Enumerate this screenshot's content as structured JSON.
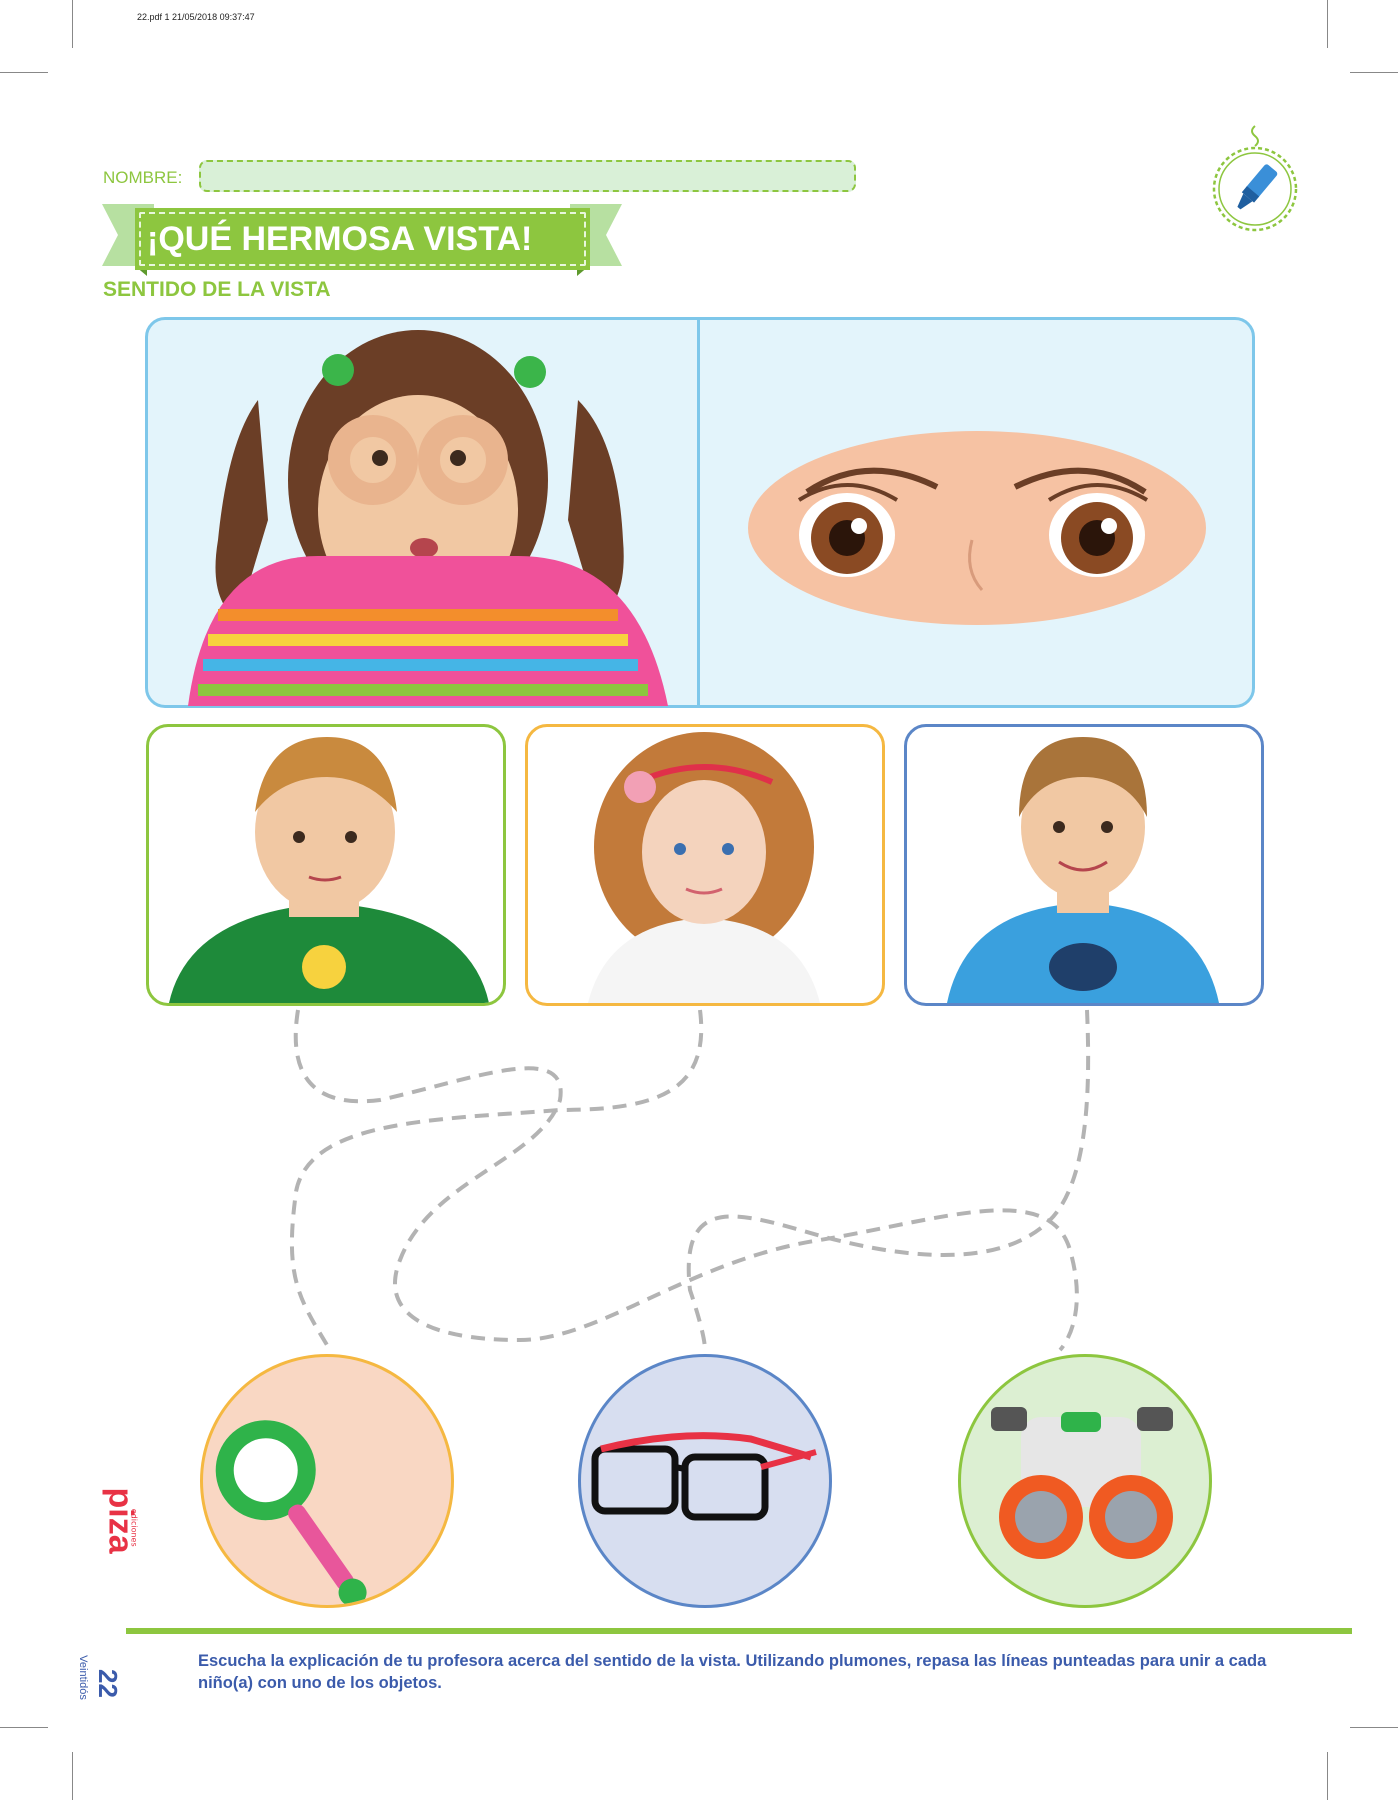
{
  "pdf_header": "22.pdf  1  21/05/2018  09:37:47",
  "nombre_label": "NOMBRE:",
  "title": "¡QUÉ HERMOSA VISTA!",
  "subtitle": "SENTIDO DE LA VISTA",
  "instructions": "Escucha la explicación de tu profesora acerca del sentido de la vista. Utilizando plumones, repasa las líneas punteadas para unir a cada niño(a) con uno de los objetos.",
  "page_number": "22",
  "page_word": "Veintidós",
  "publisher": {
    "small": "ediciones",
    "brand": "piza"
  },
  "colors": {
    "green": "#8dc63f",
    "blue": "#7ec7ea",
    "orange": "#f5b841",
    "darkblue": "#5b86c7",
    "text": "#3b5bab"
  },
  "children": [
    "boy-green-hoodie",
    "girl-curly-hair",
    "boy-blue-shirt"
  ],
  "objects": [
    "magnifying-glass",
    "glasses",
    "binoculars"
  ]
}
